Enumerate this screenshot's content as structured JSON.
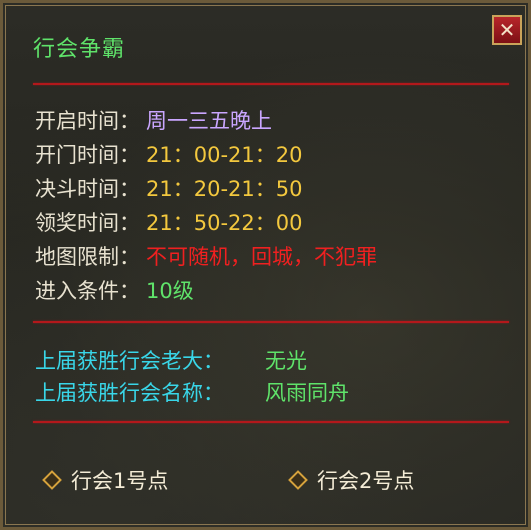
{
  "window": {
    "title": "行会争霸",
    "close_symbol": "✕"
  },
  "info": {
    "open_label": "开启时间：",
    "open_value": "周一三五晚上",
    "door_label": "开门时间：",
    "door_value": "21：00-21：20",
    "duel_label": "决斗时间：",
    "duel_value": "21：20-21：50",
    "reward_label": "领奖时间：",
    "reward_value": "21：50-22：00",
    "map_label": "地图限制：",
    "map_value": "不可随机，回城，不犯罪",
    "entry_label": "进入条件：",
    "entry_value": "10级"
  },
  "winner": {
    "leader_label": "上届获胜行会老大：",
    "leader_value": "无光",
    "guild_label": "上届获胜行会名称：",
    "guild_value": "风雨同舟"
  },
  "points": {
    "point1": "行会1号点",
    "point2": "行会2号点"
  },
  "colors": {
    "title_green": "#5fe36a",
    "divider_red": "#b3181b",
    "label_cyan": "#39d6e8",
    "value_yellow": "#f3c83e",
    "value_purple": "#caa6ff",
    "value_red": "#f02020"
  },
  "icons": {
    "close": "close-icon",
    "bullet": "diamond-icon"
  }
}
